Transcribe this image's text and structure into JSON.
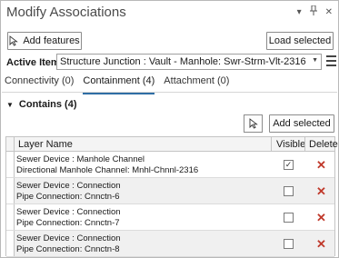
{
  "window": {
    "title": "Modify Associations",
    "controls": [
      "dropdown-icon",
      "pin-icon",
      "close-icon"
    ]
  },
  "toolbar": {
    "add_features_label": "Add features",
    "load_selected_label": "Load selected"
  },
  "active_item": {
    "label": "Active Item:",
    "value": "Structure Junction : Vault - Manhole: Swr-Strm-Vlt-2316"
  },
  "tabs": [
    {
      "label": "Connectivity (0)",
      "active": false
    },
    {
      "label": "Containment (4)",
      "active": true
    },
    {
      "label": "Attachment (0)",
      "active": false
    }
  ],
  "contains": {
    "header": "Contains (4)",
    "add_selected_label": "Add selected"
  },
  "table": {
    "columns": [
      "Layer Name",
      "Visible",
      "Delete"
    ],
    "rows": [
      {
        "line1": "Sewer Device : Manhole Channel",
        "line2": "Directional Manhole Channel: Mnhl-Chnnl-2316",
        "visible": true
      },
      {
        "line1": "Sewer Device : Connection",
        "line2": "Pipe Connection: Cnnctn-6",
        "visible": false
      },
      {
        "line1": "Sewer Device : Connection",
        "line2": "Pipe Connection: Cnnctn-7",
        "visible": false
      },
      {
        "line1": "Sewer Device : Connection",
        "line2": "Pipe Connection: Cnnctn-8",
        "visible": false
      }
    ]
  },
  "colors": {
    "accent": "#2f6ea5",
    "delete": "#c0392b"
  }
}
